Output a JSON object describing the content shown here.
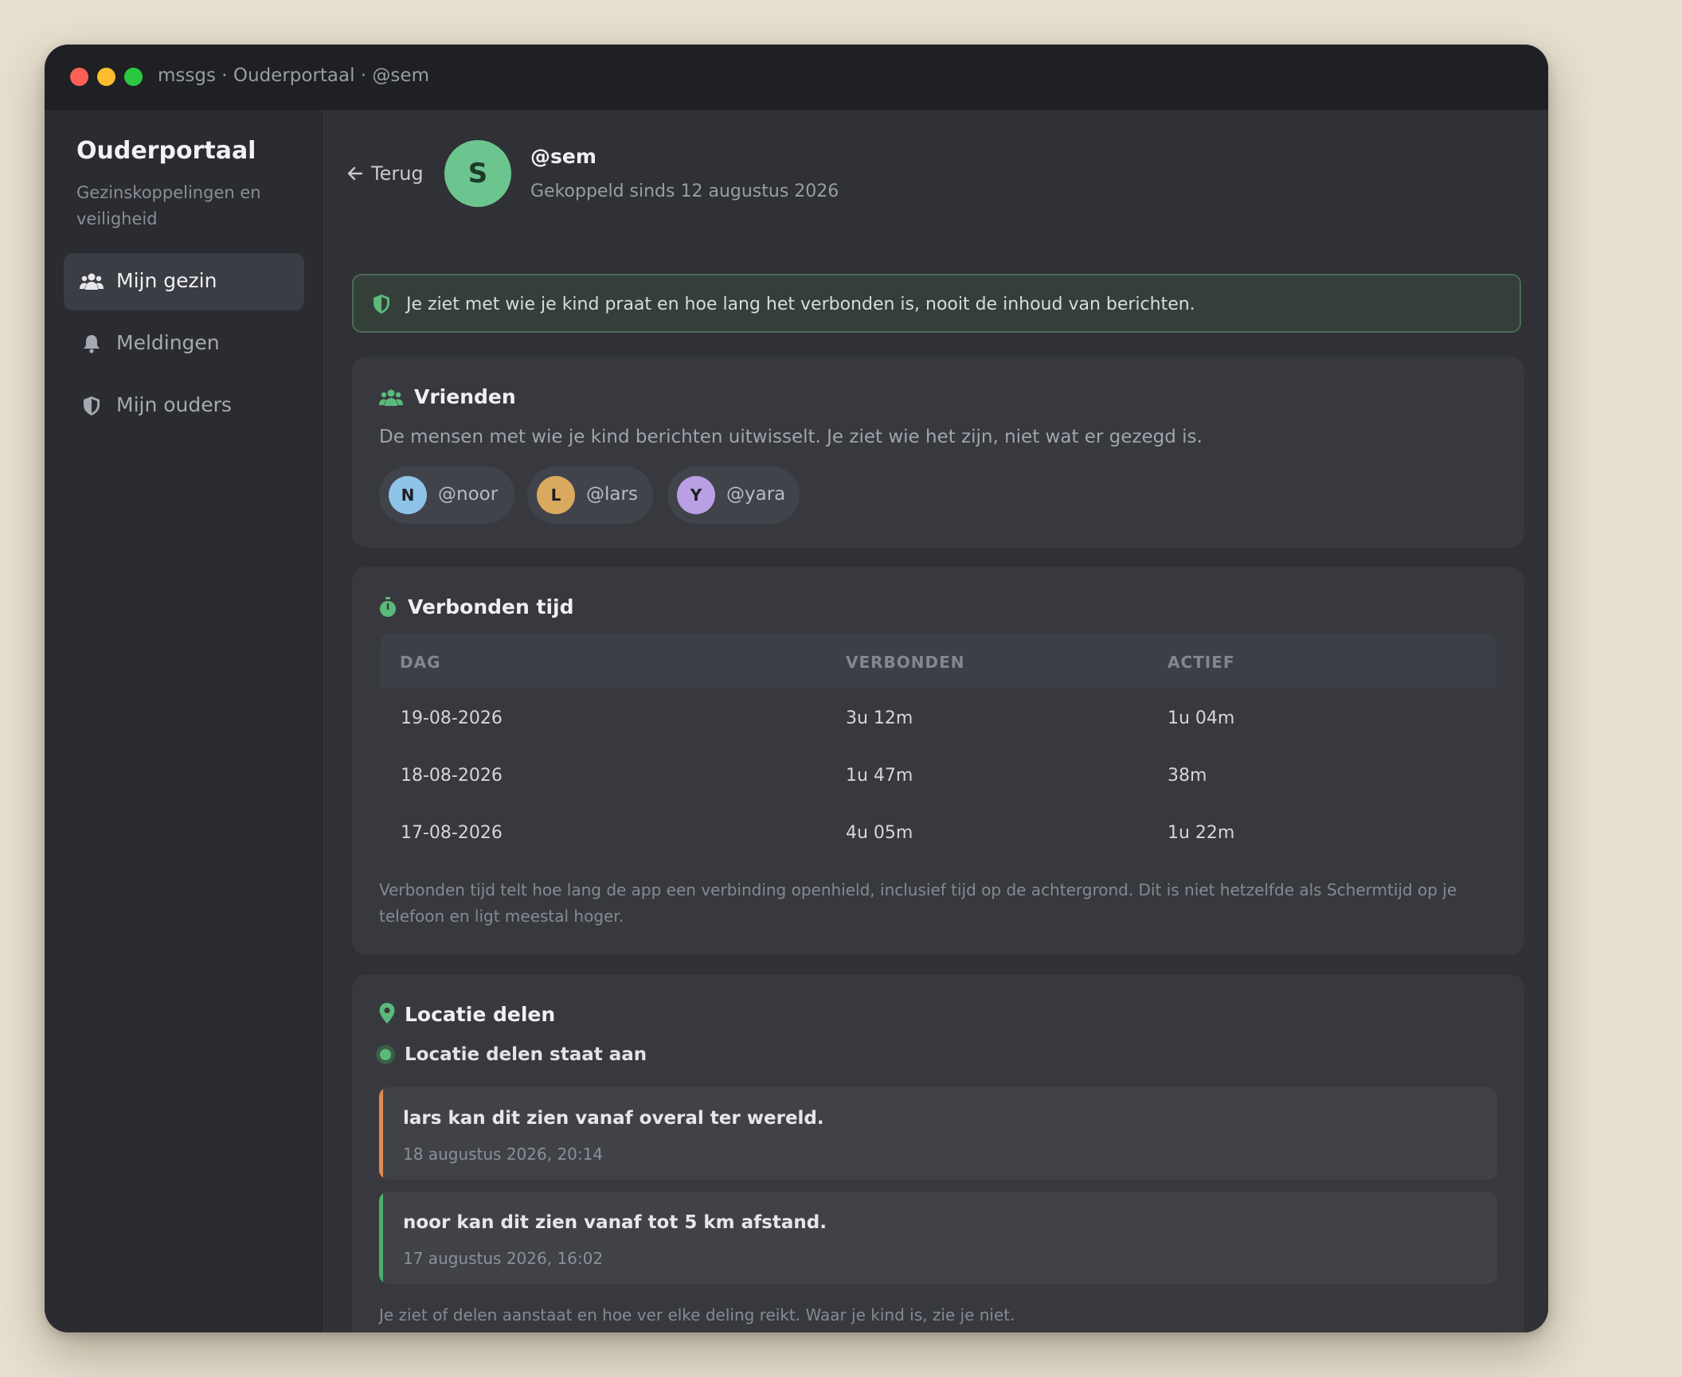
{
  "window": {
    "title": "mssgs · Ouderportaal · @sem"
  },
  "sidebar": {
    "title": "Ouderportaal",
    "subtitle": "Gezinskoppelingen en veiligheid",
    "items": [
      {
        "label": "Mijn gezin",
        "icon": "users-icon",
        "active": true
      },
      {
        "label": "Meldingen",
        "icon": "bell-icon",
        "active": false
      },
      {
        "label": "Mijn ouders",
        "icon": "shield-icon",
        "active": false
      }
    ]
  },
  "header": {
    "back_label": "Terug",
    "avatar_letter": "S",
    "handle": "@sem",
    "linked_since": "Gekoppeld sinds 12 augustus 2026"
  },
  "notice": {
    "text": "Je ziet met wie je kind praat en hoe lang het verbonden is, nooit de inhoud van berichten."
  },
  "friends": {
    "title": "Vrienden",
    "description": "De mensen met wie je kind berichten uitwisselt. Je ziet wie het zijn, niet wat er gezegd is.",
    "list": [
      {
        "letter": "N",
        "handle": "@noor",
        "color": "#8ec3ea"
      },
      {
        "letter": "L",
        "handle": "@lars",
        "color": "#d9a95e"
      },
      {
        "letter": "Y",
        "handle": "@yara",
        "color": "#b9a0e4"
      }
    ]
  },
  "connected_time": {
    "title": "Verbonden tijd",
    "columns": [
      "DAG",
      "VERBONDEN",
      "ACTIEF"
    ],
    "rows": [
      [
        "19-08-2026",
        "3u 12m",
        "1u 04m"
      ],
      [
        "18-08-2026",
        "1u 47m",
        "38m"
      ],
      [
        "17-08-2026",
        "4u 05m",
        "1u 22m"
      ]
    ],
    "footnote": "Verbonden tijd telt hoe lang de app een verbinding openhield, inclusief tijd op de achtergrond. Dit is niet hetzelfde als Schermtijd op je telefoon en ligt meestal hoger."
  },
  "location": {
    "title": "Locatie delen",
    "status": "Locatie delen staat aan",
    "shares": [
      {
        "text": "lars kan dit zien vanaf overal ter wereld.",
        "date": "18 augustus 2026, 20:14",
        "accent": "#e08a55"
      },
      {
        "text": "noor kan dit zien vanaf tot 5 km afstand.",
        "date": "17 augustus 2026, 16:02",
        "accent": "#4cae6c"
      }
    ],
    "footnote": "Je ziet of delen aanstaat en hoe ver elke deling reikt. Waar je kind is, zie je niet."
  },
  "colors": {
    "accent_green": "#5bb97a",
    "background": "#2f3136",
    "desktop": "#e7e0cf"
  }
}
